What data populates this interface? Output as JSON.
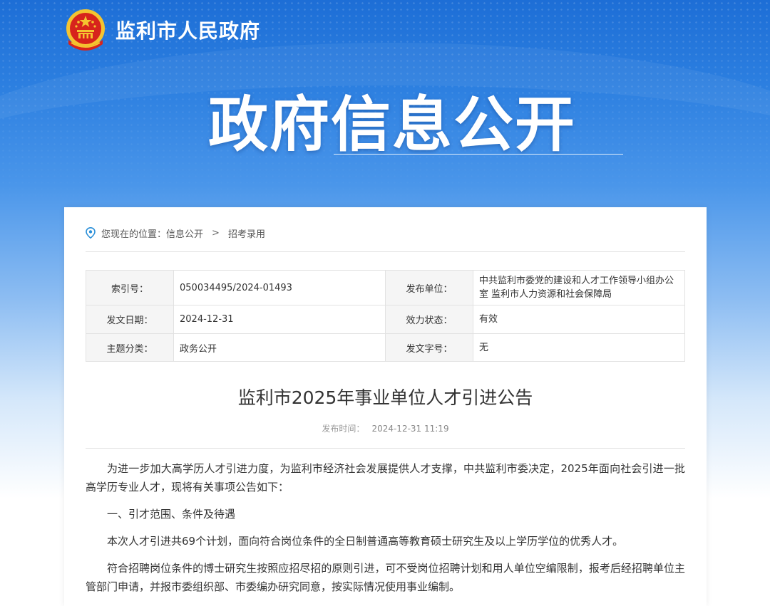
{
  "header": {
    "site_name": "监利市人民政府",
    "hero_title": "政府信息公开",
    "emblem_icon": "national-emblem-icon"
  },
  "breadcrumb": {
    "prefix": "您现在的位置：",
    "items": [
      "信息公开",
      "招考录用"
    ],
    "separator": ">"
  },
  "meta": {
    "rows": [
      {
        "k1": "索引号：",
        "v1": "050034495/2024-01493",
        "k2": "发布单位：",
        "v2": "中共监利市委党的建设和人才工作领导小组办公室 监利市人力资源和社会保障局"
      },
      {
        "k1": "发文日期：",
        "v1": "2024-12-31",
        "k2": "效力状态：",
        "v2": "有效"
      },
      {
        "k1": "主题分类：",
        "v1": "政务公开",
        "k2": "发文字号：",
        "v2": "无"
      }
    ]
  },
  "article": {
    "title": "监利市2025年事业单位人才引进公告",
    "publish_label": "发布时间：",
    "publish_time": "2024-12-31 11:19",
    "paragraphs": [
      "为进一步加大高学历人才引进力度，为监利市经济社会发展提供人才支撑，中共监利市委决定，2025年面向社会引进一批高学历专业人才，现将有关事项公告如下：",
      "一、引才范围、条件及待遇",
      "本次人才引进共69个计划，面向符合岗位条件的全日制普通高等教育硕士研究生及以上学历学位的优秀人才。",
      "符合招聘岗位条件的博士研究生按照应招尽招的原则引进，可不受岗位招聘计划和用人单位空编限制，报考后经招聘单位主管部门申请，并报市委组织部、市委编办研究同意，按实际情况使用事业编制。"
    ]
  },
  "colors": {
    "banner_top": "#1d6ed6",
    "emblem_red": "#d7241c",
    "emblem_gold": "#f4c430",
    "pin_blue": "#2a8fd8"
  }
}
